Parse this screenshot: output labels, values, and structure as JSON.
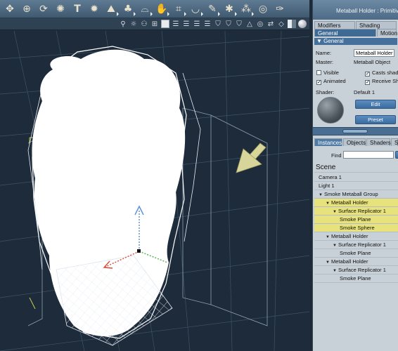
{
  "toolbar": {
    "icons": [
      "move-icon",
      "globe-icon",
      "rotate-icon",
      "twist-icon",
      "text-icon",
      "gear-ball-icon",
      "terrain-icon",
      "tree-icon",
      "lamp-icon",
      "hand-icon",
      "grid-flat-icon",
      "bowl-icon",
      "brush-icon",
      "splat-icon",
      "nodes-icon",
      "target-icon",
      "wrench-icon"
    ]
  },
  "viewbar": {
    "icons": [
      "light-icon",
      "sun-icon",
      "group-icon",
      "display-icon",
      "square-icon",
      "lines-icon",
      "lines-icon",
      "lines-icon",
      "lines-icon",
      "shield-icon",
      "shield-icon",
      "shield-icon",
      "cone-icon",
      "target-icon",
      "arrows-icon",
      "cube-icon",
      "sphere-half-icon",
      "sphere-icon"
    ]
  },
  "panel": {
    "title": "Metaball Holder : Primitive",
    "top_tabs": [
      "Modifiers",
      "Shading"
    ],
    "sub_tabs": [
      "General",
      "Motion"
    ],
    "section": "General",
    "name_label": "Name:",
    "name_value": "Metaball Holder",
    "master_label": "Master:",
    "master_value": "Metaball Object",
    "visible": {
      "label": "Visible",
      "checked": false
    },
    "casts_shadows": {
      "label": "Casts shad",
      "checked": true
    },
    "animated": {
      "label": "Animated",
      "checked": true
    },
    "receive_shadows": {
      "label": "Receive Sh",
      "checked": true
    },
    "shader_label": "Shader:",
    "shader_value": "Default 1",
    "edit_button": "Edit",
    "preset_button": "Preset"
  },
  "browser": {
    "tabs": [
      "Instances",
      "Objects",
      "Shaders",
      "S"
    ],
    "find_label": "Find",
    "find_value": "",
    "scene_label": "Scene",
    "items": [
      {
        "label": "Camera 1",
        "depth": 0,
        "expand": false,
        "highlighted": false
      },
      {
        "label": "Light 1",
        "depth": 0,
        "expand": false,
        "highlighted": false
      },
      {
        "label": "Smoke Metaball Group",
        "depth": 0,
        "expand": true,
        "highlighted": false
      },
      {
        "label": "Metaball Holder",
        "depth": 1,
        "expand": true,
        "highlighted": true
      },
      {
        "label": "Surface Replicator 1",
        "depth": 2,
        "expand": true,
        "highlighted": true
      },
      {
        "label": "Smoke Plane",
        "depth": 3,
        "expand": false,
        "highlighted": true
      },
      {
        "label": "Smoke Sphere",
        "depth": 3,
        "expand": false,
        "highlighted": true
      },
      {
        "label": "Metaball Holder",
        "depth": 1,
        "expand": true,
        "highlighted": false
      },
      {
        "label": "Surface Replicator 1",
        "depth": 2,
        "expand": true,
        "highlighted": false
      },
      {
        "label": "Smoke Plane",
        "depth": 3,
        "expand": false,
        "highlighted": false
      },
      {
        "label": "Metaball Holder",
        "depth": 1,
        "expand": true,
        "highlighted": false
      },
      {
        "label": "Surface Replicator 1",
        "depth": 2,
        "expand": true,
        "highlighted": false
      },
      {
        "label": "Smoke Plane",
        "depth": 3,
        "expand": false,
        "highlighted": false
      }
    ]
  }
}
